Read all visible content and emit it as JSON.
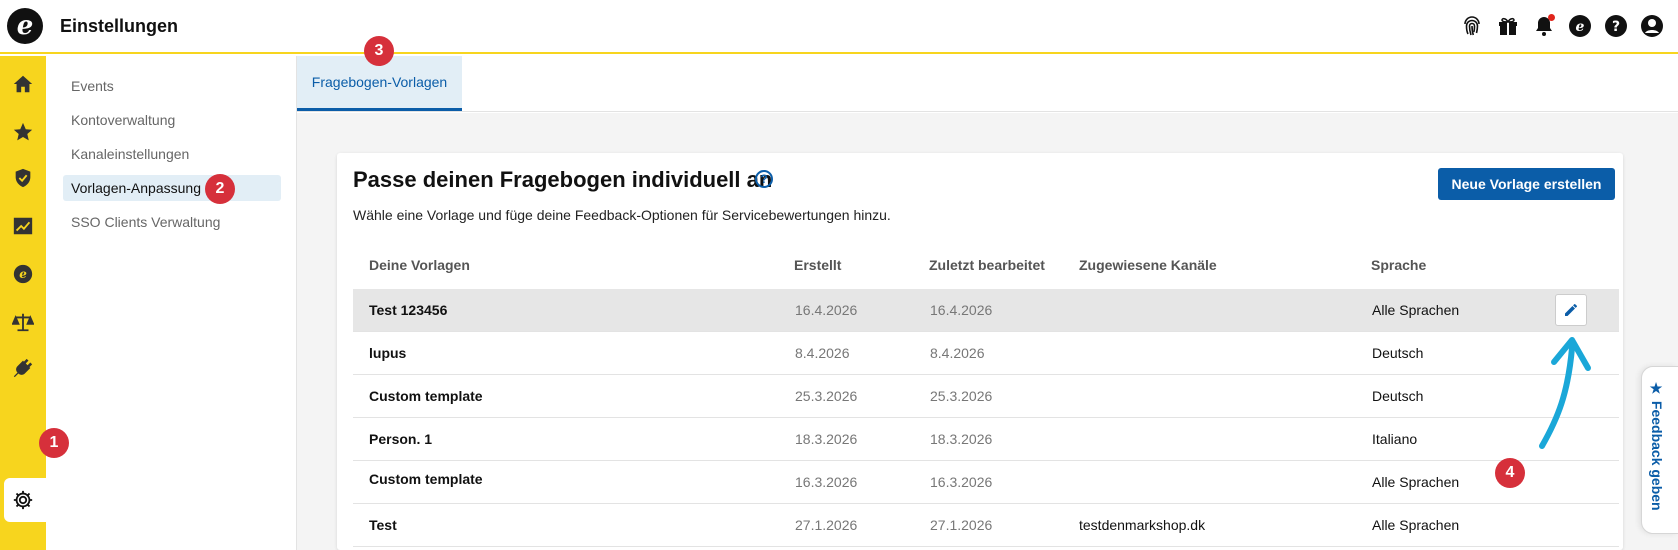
{
  "header": {
    "logo_letter": "e",
    "title": "Einstellungen",
    "icons": [
      "fingerprint-icon",
      "gift-icon",
      "bell-icon",
      "e-circle-icon",
      "help-icon",
      "user-icon"
    ]
  },
  "rail": {
    "icons": [
      "home-icon",
      "star-icon",
      "shield-icon",
      "chart-icon",
      "e-circle-icon",
      "scales-icon",
      "plug-icon",
      "gear-icon"
    ],
    "active": "gear-icon"
  },
  "submenu": {
    "items": [
      {
        "label": "Events"
      },
      {
        "label": "Kontoverwaltung"
      },
      {
        "label": "Kanaleinstellungen"
      },
      {
        "label": "Vorlagen-Anpassung"
      },
      {
        "label": "SSO Clients Verwaltung"
      }
    ],
    "active_index": 3
  },
  "tabs": [
    {
      "label": "Fragebogen-Vorlagen"
    }
  ],
  "card": {
    "title": "Passe deinen Fragebogen individuell an",
    "help_symbol": "?",
    "subtitle": "Wähle eine Vorlage und füge deine Feedback-Optionen für Servicebewertungen hinzu.",
    "new_button": "Neue Vorlage erstellen"
  },
  "table": {
    "headers": [
      "Deine Vorlagen",
      "Erstellt",
      "Zuletzt bearbeitet",
      "Zugewiesene Kanäle",
      "Sprache"
    ],
    "rows": [
      {
        "name": "Test 123456",
        "created": "16.4.2026",
        "edited": "16.4.2026",
        "channels": "",
        "language": "Alle Sprachen"
      },
      {
        "name": "lupus",
        "created": "8.4.2026",
        "edited": "8.4.2026",
        "channels": "",
        "language": "Deutsch"
      },
      {
        "name": "Custom template",
        "created": "25.3.2026",
        "edited": "25.3.2026",
        "channels": "",
        "language": "Deutsch"
      },
      {
        "name": "Person. 1",
        "created": "18.3.2026",
        "edited": "18.3.2026",
        "channels": "",
        "language": "Italiano"
      },
      {
        "name": "Custom template",
        "created": "16.3.2026",
        "edited": "16.3.2026",
        "channels": "",
        "language": "Alle Sprachen"
      },
      {
        "name": "Test",
        "created": "27.1.2026",
        "edited": "27.1.2026",
        "channels": "testdenmarkshop.dk",
        "language": "Alle Sprachen"
      }
    ]
  },
  "feedback_tab": {
    "label": "Feedback geben"
  },
  "annotations": [
    "1",
    "2",
    "3",
    "4"
  ],
  "colors": {
    "accent": "#0b5da8",
    "rail": "#f7d51e",
    "badge": "#d6303b",
    "arrow": "#1aa7d8"
  }
}
